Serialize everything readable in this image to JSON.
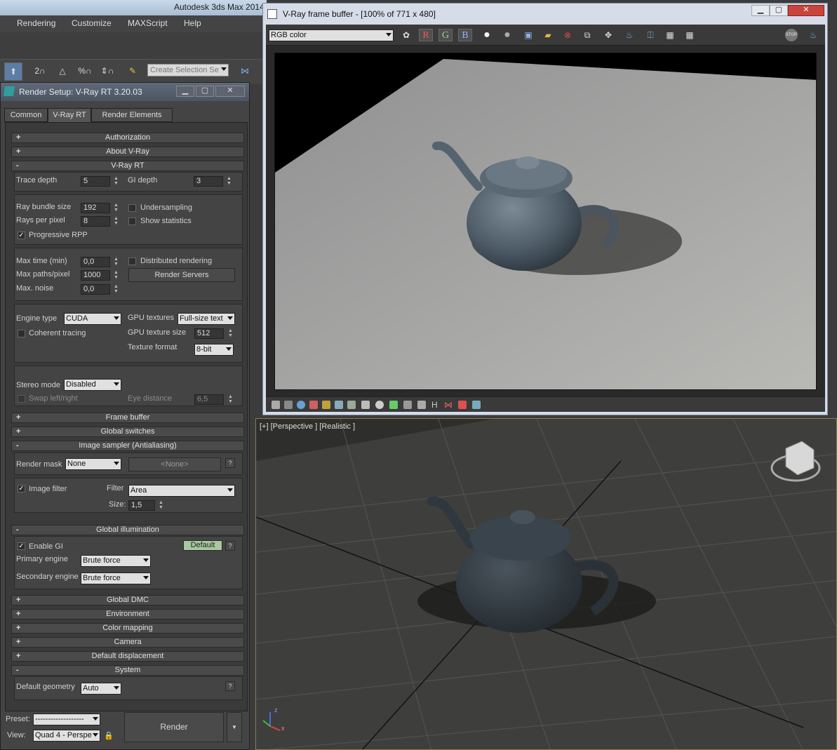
{
  "app": {
    "title": "Autodesk 3ds Max  2014"
  },
  "menubar": [
    "Rendering",
    "Customize",
    "MAXScript",
    "Help"
  ],
  "toolbar": {
    "selection_set_placeholder": "Create Selection Se",
    "snap_labels": [
      "2",
      "%",
      "⌂"
    ]
  },
  "render_setup": {
    "title": "Render Setup: V-Ray RT 3.20.03",
    "tabs": [
      "Common",
      "V-Ray RT",
      "Render Elements"
    ],
    "rollouts": {
      "authorization": "Authorization",
      "about": "About V-Ray",
      "vray_rt": "V-Ray RT",
      "frame_buffer": "Frame buffer",
      "global_switches": "Global switches",
      "image_sampler": "Image sampler (Antialiasing)",
      "global_illumination": "Global illumination",
      "global_dmc": "Global DMC",
      "environment": "Environment",
      "color_mapping": "Color mapping",
      "camera": "Camera",
      "default_displacement": "Default displacement",
      "system": "System"
    },
    "trace_depth": {
      "label": "Trace depth",
      "value": "5"
    },
    "gi_depth": {
      "label": "GI depth",
      "value": "3"
    },
    "ray_bundle_size": {
      "label": "Ray bundle size",
      "value": "192"
    },
    "rays_per_pixel": {
      "label": "Rays per pixel",
      "value": "8"
    },
    "undersampling": {
      "label": "Undersampling",
      "checked": ""
    },
    "show_statistics": {
      "label": "Show statistics",
      "checked": ""
    },
    "progressive_rpp": {
      "label": "Progressive RPP",
      "checked": "✓"
    },
    "max_time": {
      "label": "Max time (min)",
      "value": "0,0"
    },
    "max_paths": {
      "label": "Max paths/pixel",
      "value": "1000"
    },
    "max_noise": {
      "label": "Max. noise",
      "value": "0,0"
    },
    "distributed_rendering": {
      "label": "Distributed rendering",
      "checked": ""
    },
    "render_servers": "Render Servers",
    "engine_type": {
      "label": "Engine type",
      "value": "CUDA"
    },
    "gpu_textures": {
      "label": "GPU textures",
      "value": "Full-size text"
    },
    "coherent_tracing": {
      "label": "Coherent tracing",
      "checked": ""
    },
    "gpu_texture_size": {
      "label": "GPU texture size",
      "value": "512"
    },
    "texture_format": {
      "label": "Texture format",
      "value": "8-bit"
    },
    "stereo_mode": {
      "label": "Stereo mode",
      "value": "Disabled"
    },
    "swap_left_right": {
      "label": "Swap left/right",
      "checked": ""
    },
    "eye_distance": {
      "label": "Eye distance",
      "value": "6,5"
    },
    "render_mask": {
      "label": "Render mask",
      "value": "None",
      "map": "<None>"
    },
    "image_filter": {
      "label": "Image filter",
      "checked": "✓",
      "filter_label": "Filter",
      "filter_value": "Area",
      "size_label": "Size:",
      "size_value": "1,5"
    },
    "enable_gi": {
      "label": "Enable GI",
      "checked": "✓",
      "mode": "Default"
    },
    "primary_engine": {
      "label": "Primary engine",
      "value": "Brute force"
    },
    "secondary_engine": {
      "label": "Secondary engine",
      "value": "Brute force"
    },
    "default_geometry": {
      "label": "Default geometry",
      "value": "Auto"
    },
    "help_mark": "?",
    "preset": {
      "label": "Preset:",
      "value": "-------------------"
    },
    "view": {
      "label": "View:",
      "value": "Quad 4 - Perspe"
    },
    "render_button": "Render"
  },
  "frame_buffer": {
    "title": "V-Ray frame buffer - [100% of 771 x 480]",
    "channel": "RGB color",
    "channels": [
      "R",
      "G",
      "B"
    ],
    "stop_label": "STOP"
  },
  "viewport": {
    "label": "[+] [Perspective ] [Realistic ]",
    "axis_z": "z",
    "axis_x": "x"
  },
  "colors": {
    "title_bar": "#5e6a79",
    "panel": "#3a3a3a",
    "button": "#4a4a4a",
    "default_badge": "#a8c8a0",
    "viewport_border": "#8a7f45"
  }
}
